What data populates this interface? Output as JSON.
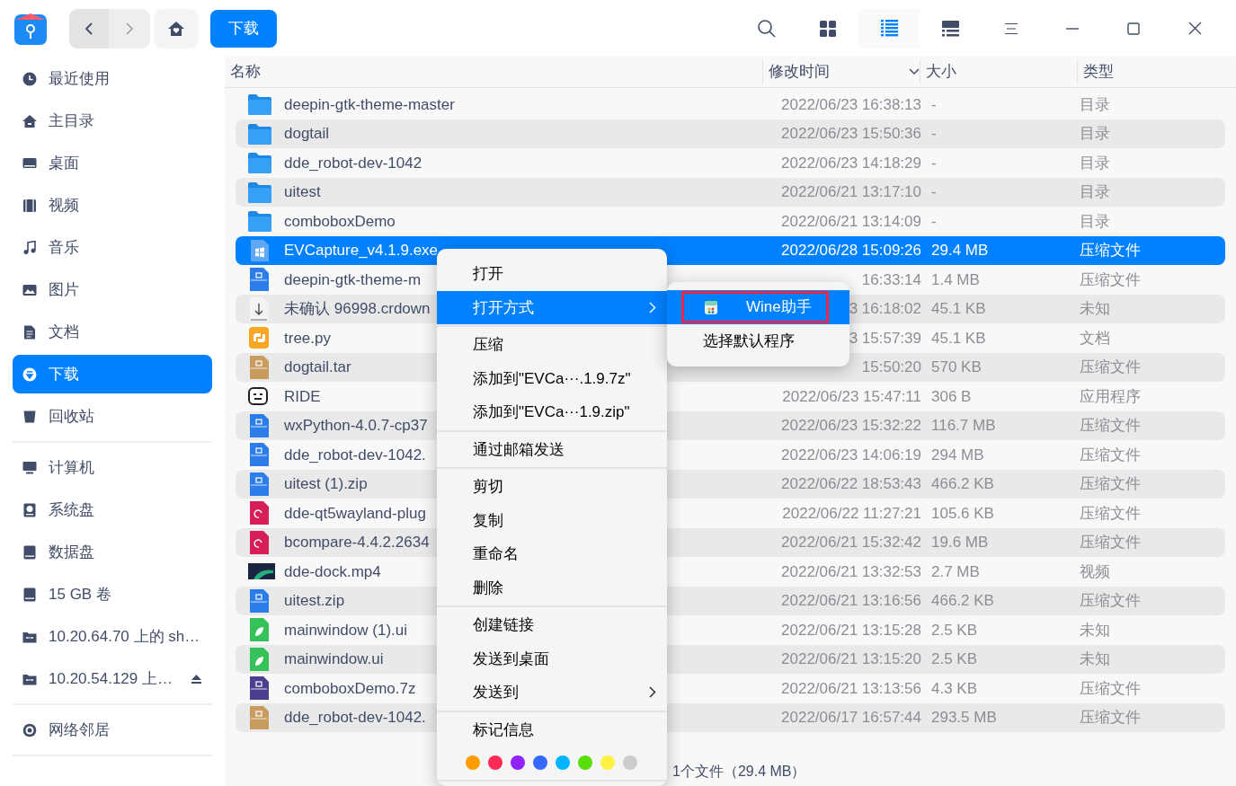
{
  "toolbar": {
    "breadcrumb": "下载",
    "view_buttons": [
      {
        "kind": "icon",
        "selected": false
      },
      {
        "kind": "list",
        "selected": true
      },
      {
        "kind": "tree",
        "selected": false
      }
    ]
  },
  "sidebar": {
    "sections": [
      [
        {
          "label": "最近使用",
          "selected": false,
          "ejectable": false
        },
        {
          "label": "主目录",
          "selected": false,
          "ejectable": false
        },
        {
          "label": "桌面",
          "selected": false,
          "ejectable": false
        },
        {
          "label": "视频",
          "selected": false,
          "ejectable": false
        },
        {
          "label": "音乐",
          "selected": false,
          "ejectable": false
        },
        {
          "label": "图片",
          "selected": false,
          "ejectable": false
        },
        {
          "label": "文档",
          "selected": false,
          "ejectable": false
        },
        {
          "label": "下载",
          "selected": true,
          "ejectable": false
        },
        {
          "label": "回收站",
          "selected": false,
          "ejectable": false
        }
      ],
      [
        {
          "label": "计算机",
          "selected": false,
          "ejectable": false
        },
        {
          "label": "系统盘",
          "selected": false,
          "ejectable": false
        },
        {
          "label": "数据盘",
          "selected": false,
          "ejectable": false
        },
        {
          "label": "15 GB 卷",
          "selected": false,
          "ejectable": false
        },
        {
          "label": "10.20.64.70 上的 sh…",
          "selected": false,
          "ejectable": false
        },
        {
          "label": "10.20.54.129 上…",
          "selected": false,
          "ejectable": true
        }
      ],
      [
        {
          "label": "网络邻居",
          "selected": false,
          "ejectable": false
        }
      ]
    ]
  },
  "table": {
    "columns": [
      "名称",
      "修改时间",
      "大小",
      "类型"
    ],
    "rows": [
      {
        "kind": "folder",
        "name": "deepin-gtk-theme-master",
        "modified": "2022/06/23 16:38:13",
        "size": "-",
        "type": "目录",
        "selected": false
      },
      {
        "kind": "folder",
        "name": "dogtail",
        "modified": "2022/06/23 15:50:36",
        "size": "-",
        "type": "目录",
        "selected": false
      },
      {
        "kind": "folder",
        "name": "dde_robot-dev-1042",
        "modified": "2022/06/23 14:18:29",
        "size": "-",
        "type": "目录",
        "selected": false
      },
      {
        "kind": "folder",
        "name": "uitest",
        "modified": "2022/06/21 13:17:10",
        "size": "-",
        "type": "目录",
        "selected": false
      },
      {
        "kind": "folder",
        "name": "comboboxDemo",
        "modified": "2022/06/21 13:14:09",
        "size": "-",
        "type": "目录",
        "selected": false
      },
      {
        "kind": "exe",
        "name": "EVCapture_v4.1.9.exe",
        "modified": "2022/06/28 15:09:26",
        "size": "29.4 MB",
        "type": "压缩文件",
        "selected": true
      },
      {
        "kind": "zip",
        "name": "deepin-gtk-theme-m",
        "modified": "16:33:14",
        "size": "1.4 MB",
        "type": "压缩文件",
        "selected": false
      },
      {
        "kind": "download",
        "name": "未确认 96998.crdown",
        "modified": "3 16:18:02",
        "size": "45.1 KB",
        "type": "未知",
        "selected": false
      },
      {
        "kind": "python",
        "name": "tree.py",
        "modified": "3 15:57:39",
        "size": "45.1 KB",
        "type": "文档",
        "selected": false
      },
      {
        "kind": "tar",
        "name": "dogtail.tar",
        "modified": "15:50:20",
        "size": "570 KB",
        "type": "压缩文件",
        "selected": false
      },
      {
        "kind": "app",
        "name": "RIDE",
        "modified": "2022/06/23 15:47:11",
        "size": "306 B",
        "type": "应用程序",
        "selected": false
      },
      {
        "kind": "zip",
        "name": "wxPython-4.0.7-cp37",
        "modified": "2022/06/23 15:32:22",
        "size": "116.7 MB",
        "type": "压缩文件",
        "selected": false
      },
      {
        "kind": "zip",
        "name": "dde_robot-dev-1042.",
        "modified": "2022/06/23 14:06:19",
        "size": "294 MB",
        "type": "压缩文件",
        "selected": false
      },
      {
        "kind": "zip",
        "name": "uitest (1).zip",
        "modified": "2022/06/22 18:53:43",
        "size": "466.2 KB",
        "type": "压缩文件",
        "selected": false
      },
      {
        "kind": "deb",
        "name": "dde-qt5wayland-plug",
        "modified": "2022/06/22 11:27:21",
        "size": "105.6 KB",
        "type": "压缩文件",
        "selected": false
      },
      {
        "kind": "deb",
        "name": "bcompare-4.4.2.2634",
        "modified": "2022/06/21 15:32:42",
        "size": "19.6 MB",
        "type": "压缩文件",
        "selected": false
      },
      {
        "kind": "video",
        "name": "dde-dock.mp4",
        "modified": "2022/06/21 13:32:53",
        "size": "2.7 MB",
        "type": "视频",
        "selected": false
      },
      {
        "kind": "zip",
        "name": "uitest.zip",
        "modified": "2022/06/21 13:16:56",
        "size": "466.2 KB",
        "type": "压缩文件",
        "selected": false
      },
      {
        "kind": "ui",
        "name": "mainwindow (1).ui",
        "modified": "2022/06/21 13:15:28",
        "size": "2.5 KB",
        "type": "未知",
        "selected": false
      },
      {
        "kind": "ui",
        "name": "mainwindow.ui",
        "modified": "2022/06/21 13:15:20",
        "size": "2.5 KB",
        "type": "未知",
        "selected": false
      },
      {
        "kind": "sevenzip",
        "name": "comboboxDemo.7z",
        "modified": "2022/06/21 13:13:56",
        "size": "4.3 KB",
        "type": "压缩文件",
        "selected": false
      },
      {
        "kind": "tar",
        "name": "dde_robot-dev-1042.",
        "modified": "2022/06/17 16:57:44",
        "size": "293.5 MB",
        "type": "压缩文件",
        "selected": false
      }
    ]
  },
  "status_bar": "1个文件（29.4 MB）",
  "context_menu": {
    "items": [
      {
        "kind": "item",
        "label": "打开",
        "selected": false
      },
      {
        "kind": "submenu",
        "label": "打开方式",
        "selected": true
      },
      {
        "kind": "separator"
      },
      {
        "kind": "item",
        "label": "压缩",
        "selected": false
      },
      {
        "kind": "item",
        "label": "添加到\"EVCa···.1.9.7z\"",
        "selected": false
      },
      {
        "kind": "item",
        "label": "添加到\"EVCa···1.9.zip\"",
        "selected": false
      },
      {
        "kind": "separator"
      },
      {
        "kind": "item",
        "label": "通过邮箱发送",
        "selected": false
      },
      {
        "kind": "separator"
      },
      {
        "kind": "item",
        "label": "剪切",
        "selected": false
      },
      {
        "kind": "item",
        "label": "复制",
        "selected": false
      },
      {
        "kind": "item",
        "label": "重命名",
        "selected": false
      },
      {
        "kind": "item",
        "label": "删除",
        "selected": false
      },
      {
        "kind": "separator"
      },
      {
        "kind": "item",
        "label": "创建链接",
        "selected": false
      },
      {
        "kind": "item",
        "label": "发送到桌面",
        "selected": false
      },
      {
        "kind": "submenu",
        "label": "发送到",
        "selected": false
      },
      {
        "kind": "separator"
      },
      {
        "kind": "item",
        "label": "标记信息",
        "selected": false
      },
      {
        "kind": "tags",
        "colors": [
          {
            "color": "#ff9c00"
          },
          {
            "color": "#ff2a55"
          },
          {
            "color": "#9023fc"
          },
          {
            "color": "#3468ff"
          },
          {
            "color": "#00b5ff"
          },
          {
            "color": "#58df0a"
          },
          {
            "color": "#fef144"
          },
          {
            "color": "#cccccc"
          }
        ]
      },
      {
        "kind": "separator"
      }
    ]
  },
  "submenu": {
    "items": [
      {
        "label": "Wine助手",
        "kind": "app",
        "selected": true
      },
      {
        "label": "选择默认程序",
        "kind": "text",
        "selected": false
      }
    ]
  }
}
